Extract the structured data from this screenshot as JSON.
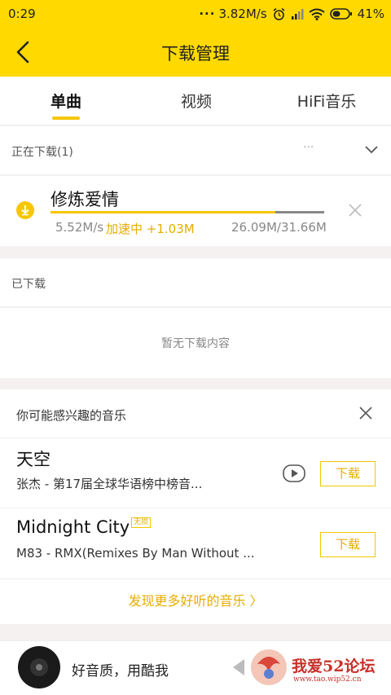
{
  "status_bar": {
    "time": "0:29",
    "network_speed": "3.82M/s",
    "battery": "41%"
  },
  "header": {
    "title": "下载管理"
  },
  "tabs": [
    {
      "label": "单曲",
      "active": true
    },
    {
      "label": "视频",
      "active": false
    },
    {
      "label": "HiFi音乐",
      "active": false
    }
  ],
  "downloading": {
    "section_label": "正在下载(1)",
    "more_glyph": "···",
    "item": {
      "title": "修炼爱情",
      "speed": "5.52M/s",
      "boost": "加速中 +1.03M",
      "size": "26.09M/31.66M",
      "progress": 0.82
    }
  },
  "downloaded": {
    "section_label": "已下载",
    "empty_message": "暂无下载内容"
  },
  "recommend": {
    "section_label": "你可能感兴趣的音乐",
    "items": [
      {
        "title": "天空",
        "subtitle": "张杰 - 第17届全球华语榜中榜音...",
        "has_video": true,
        "badge": "",
        "button": "下载"
      },
      {
        "title": "Midnight City",
        "subtitle": "M83 - RMX(Remixes By Man Without ...",
        "has_video": false,
        "badge": "无损",
        "button": "下载"
      }
    ],
    "more_link": "发现更多好听的音乐 〉"
  },
  "player": {
    "label": "好音质，用酷我"
  },
  "watermark": {
    "text": "我爱52论坛",
    "url": "www.tao.wip52.cn"
  },
  "colors": {
    "brand_yellow": "#ffd900",
    "accent": "#e6ad00"
  }
}
